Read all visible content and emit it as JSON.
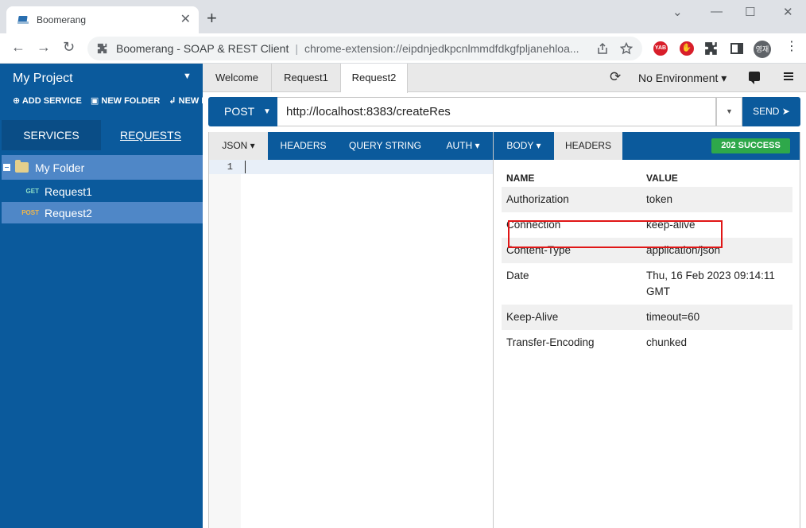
{
  "browser": {
    "tab_title": "Boomerang",
    "tab_close": "✕",
    "new_tab": "+",
    "window_controls": {
      "minimize": "—",
      "maximize": "☐",
      "close": "✕",
      "tab_search": "⌄"
    },
    "omnibox": {
      "page_title": "Boomerang - SOAP & REST Client",
      "separator": "|",
      "url": "chrome-extension://eipdnjedkpcnlmmdfdkgfpljanehloa..."
    },
    "extensions": {
      "yab": "YAB",
      "stop": "✋"
    },
    "avatar_text": "영재",
    "nav": {
      "back": "←",
      "forward": "→",
      "reload": "↻"
    },
    "menu_glyph": "⋮"
  },
  "sidebar": {
    "project_title": "My Project",
    "project_caret": "▼",
    "actions": [
      {
        "label": "⊕ ADD SERVICE"
      },
      {
        "label": "▣ NEW FOLDER"
      },
      {
        "label": "↲ NEW REQUEST"
      }
    ],
    "tabs": [
      {
        "label": "SERVICES"
      },
      {
        "label": "REQUESTS"
      }
    ],
    "folder": {
      "label": "My Folder"
    },
    "requests": [
      {
        "method": "GET",
        "name": "Request1"
      },
      {
        "method": "POST",
        "name": "Request2"
      }
    ]
  },
  "main": {
    "tabs": [
      {
        "label": "Welcome"
      },
      {
        "label": "Request1"
      },
      {
        "label": "Request2"
      }
    ],
    "environment": {
      "label": "No Environment ▾",
      "refresh": "⟳"
    },
    "request": {
      "method": "POST",
      "method_caret": "▼",
      "url": "http://localhost:8383/createRes",
      "url_dropdown": "▼",
      "send_label": "SEND ➤"
    },
    "request_tabs": [
      {
        "label": "JSON ▾"
      },
      {
        "label": "HEADERS"
      },
      {
        "label": "QUERY STRING"
      },
      {
        "label": "AUTH ▾"
      }
    ],
    "editor": {
      "line_number": "1"
    },
    "response_tabs": [
      {
        "label": "BODY ▾"
      },
      {
        "label": "HEADERS"
      }
    ],
    "status": "202 SUCCESS",
    "headers_table": {
      "columns": [
        "NAME",
        "VALUE"
      ],
      "rows": [
        {
          "name": "Authorization",
          "value": "token"
        },
        {
          "name": "Connection",
          "value": "keep-alive"
        },
        {
          "name": "Content-Type",
          "value": "application/json"
        },
        {
          "name": "Date",
          "value": "Thu, 16 Feb 2023 09:14:11 GMT"
        },
        {
          "name": "Keep-Alive",
          "value": "timeout=60"
        },
        {
          "name": "Transfer-Encoding",
          "value": "chunked"
        }
      ]
    }
  },
  "colors": {
    "brand_blue": "#0b5a9c",
    "selected_row": "#4f87c7",
    "success": "#2ea84a",
    "highlight": "#e01616"
  }
}
